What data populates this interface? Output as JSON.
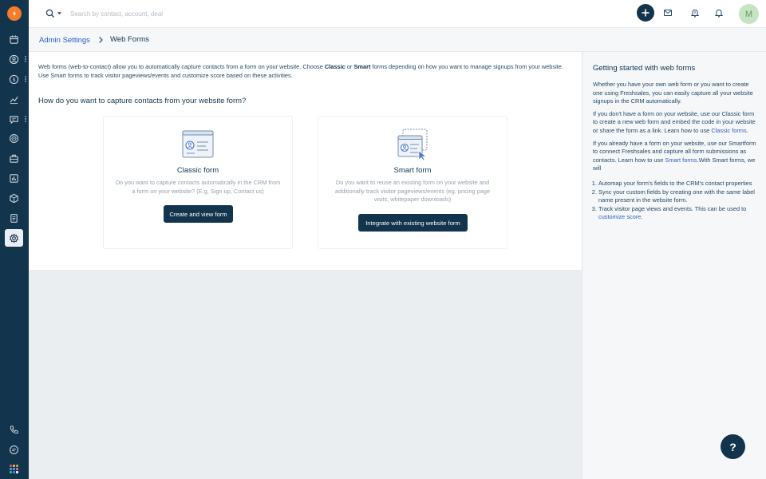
{
  "colors": {
    "sidebar": "#12344d",
    "accent": "#2c5cc5",
    "logo": "#f57c2a",
    "button": "#12344d"
  },
  "sidebar": {
    "logo_icon": "freshsales-logo-icon",
    "items": [
      {
        "name": "calendar-icon"
      },
      {
        "name": "contacts-icon"
      },
      {
        "name": "deals-icon"
      },
      {
        "name": "reports-icon"
      },
      {
        "name": "conversations-icon"
      },
      {
        "name": "goals-icon"
      },
      {
        "name": "products-icon"
      },
      {
        "name": "analytics-icon"
      },
      {
        "name": "cpq-icon"
      },
      {
        "name": "documents-icon"
      },
      {
        "name": "settings-icon",
        "active": true
      },
      {
        "name": "phone-icon"
      },
      {
        "name": "chat-icon"
      }
    ],
    "apps_icon": "apps-grid-icon"
  },
  "topbar": {
    "search_placeholder": "Search by contact, account, deal",
    "avatar_initial": "M",
    "icons": [
      "search-icon",
      "add-icon",
      "mail-icon",
      "notification-bell-icon",
      "bell-icon"
    ]
  },
  "breadcrumb": {
    "parent": "Admin Settings",
    "current": "Web Forms"
  },
  "main": {
    "intro_part1": "Web forms (web-to-contact) allow you to automatically capture contacts from a form on your website. Choose ",
    "intro_classic": "Classic",
    "intro_or": " or ",
    "intro_smart": "Smart",
    "intro_part2": " forms depending on how you want to manage signups from your website. Use Smart forms to track visitor pageviews/events and customize score based on these activities.",
    "question": "How do you want to capture contacts from your website form?",
    "cards": [
      {
        "title": "Classic form",
        "description": "Do you want to capture contacts automatically in the CRM from a form on your website? (E.g, Sign up, Contact us)",
        "button": "Create and view form"
      },
      {
        "title": "Smart form",
        "description": "Do you want to reuse an existing form on your website and additionally track visitor pageviews/events (eg. pricing page visits, whitepaper downloads)",
        "button": "Integrate with existing website form"
      }
    ]
  },
  "rightpanel": {
    "title": "Getting started with web forms",
    "p1": "Whether you have your own web form or you want to create one using Freshsales, you can easily capture all your website signups in the CRM automatically.",
    "p2_text": "If you don't have a form on your website, use our Classic form to create a new web form and embed the code in your website or share the form as a link. Learn how to use ",
    "p2_link": "Classic forms",
    "p2_end": ".",
    "p3_text": "If you already have a form on your website, use our Smartform to connect Freshsales and capture all form submissions as contacts. Learn how to use ",
    "p3_link": "Smart forms",
    "p3_end": ".With Smart forms, we will",
    "list": [
      {
        "text": "Automap your form's fields to the CRM's contact properties"
      },
      {
        "text": "Sync your custom fields by creating one with the same label name present in the website form."
      },
      {
        "text": "Track visitor page views and events. This can be used to ",
        "link": "customize score",
        "end": "."
      }
    ]
  },
  "help": {
    "label": "?"
  }
}
